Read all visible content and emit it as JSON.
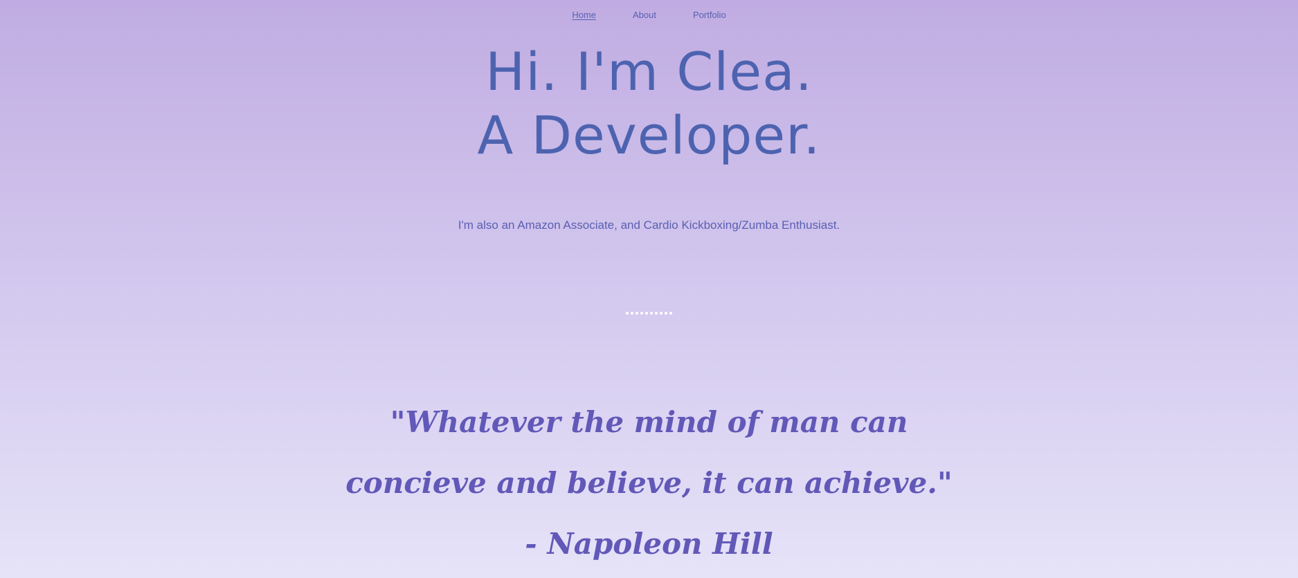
{
  "nav": {
    "items": [
      {
        "label": "Home",
        "active": true
      },
      {
        "label": "About",
        "active": false
      },
      {
        "label": "Portfolio",
        "active": false
      }
    ]
  },
  "hero": {
    "line1": "Hi. I'm Clea.",
    "line2": "A Developer.",
    "subtitle": "I'm also an Amazon Associate, and Cardio Kickboxing/Zumba Enthusiast."
  },
  "carousel": {
    "dot_count": 10
  },
  "quote": {
    "text": "\"Whatever the mind of man can concieve and believe, it can achieve.\" - Napoleon Hill"
  },
  "colors": {
    "background_top": "#c0ace2",
    "background_bottom": "#e6e3f8",
    "heading": "#4d63b0",
    "text": "#5a5fb2",
    "quote": "#6158b8",
    "dot": "#ffffff"
  }
}
